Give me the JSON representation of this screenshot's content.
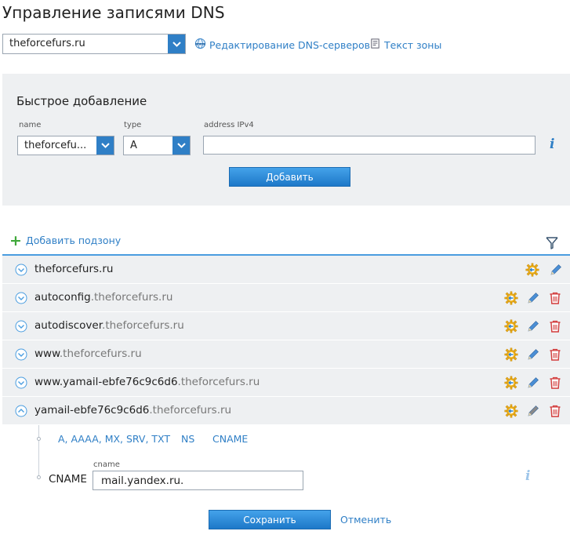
{
  "page": {
    "title": "Управление записями DNS"
  },
  "topbar": {
    "domain_select": "theforcefurs.ru",
    "edit_dns_link": "Редактирование DNS-серверов",
    "zone_text_link": "Текст зоны"
  },
  "quick_add": {
    "title": "Быстрое добавление",
    "name_label": "name",
    "name_value": "theforcefu...",
    "type_label": "type",
    "type_value": "A",
    "address_label": "address IPv4",
    "address_value": "",
    "add_button": "Добавить"
  },
  "records_toolbar": {
    "add_subzone": "Добавить подзону"
  },
  "records": [
    {
      "prefix": "theforcefurs.ru",
      "domain": "",
      "expanded": false
    },
    {
      "prefix": "autoconfig",
      "domain": ".theforcefurs.ru",
      "expanded": false
    },
    {
      "prefix": "autodiscover",
      "domain": ".theforcefurs.ru",
      "expanded": false
    },
    {
      "prefix": "www",
      "domain": ".theforcefurs.ru",
      "expanded": false
    },
    {
      "prefix": "www.yamail-ebfe76c9c6d6",
      "domain": ".theforcefurs.ru",
      "expanded": false
    },
    {
      "prefix": "yamail-ebfe76c9c6d6",
      "domain": ".theforcefurs.ru",
      "expanded": true
    }
  ],
  "detail": {
    "tabs": [
      "A, AAAA, MX, SRV, TXT",
      "NS",
      "CNAME"
    ],
    "record_type": "CNAME",
    "field_label": "cname",
    "field_value": "mail.yandex.ru.",
    "save_button": "Сохранить",
    "cancel_link": "Отменить"
  },
  "colors": {
    "accent": "#2f7fc6",
    "panel_bg": "#eef0f2",
    "delete_red": "#d23b3b",
    "plus_green": "#3fa83a"
  },
  "icons": [
    "chevron-down-icon",
    "globe-icon",
    "document-icon",
    "info-icon",
    "plus-icon",
    "filter-icon",
    "chevron-circle-icon",
    "gear-arrow-icon",
    "pencil-icon",
    "trash-icon"
  ]
}
